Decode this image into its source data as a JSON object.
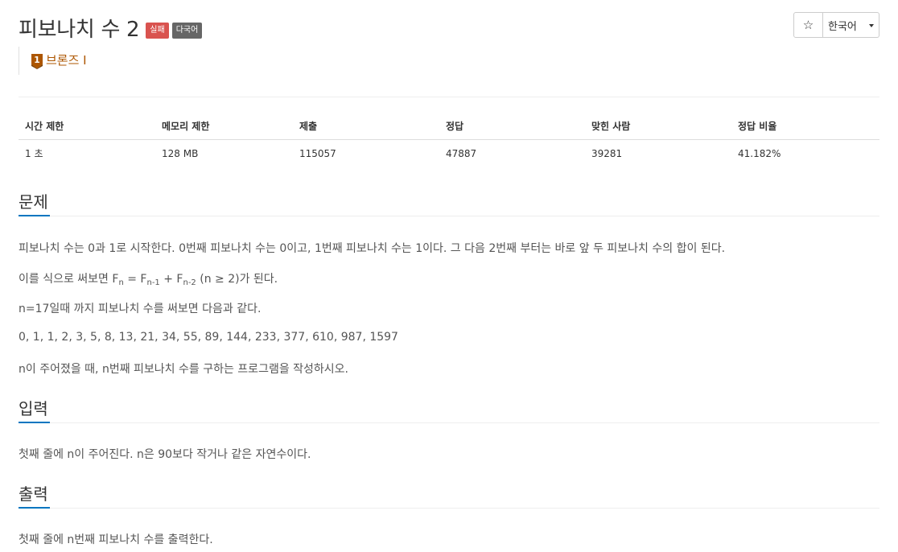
{
  "problem": {
    "title": "피보나치 수 2",
    "badges": [
      {
        "label": "실패",
        "color": "#d9534f"
      },
      {
        "label": "다국어",
        "color": "#666666"
      }
    ],
    "tier": {
      "number": "1",
      "label": "브론즈 I",
      "color": "#ad5600"
    }
  },
  "header_buttons": {
    "star_icon": "☆",
    "language": "한국어"
  },
  "info_table": {
    "headers": [
      "시간 제한",
      "메모리 제한",
      "제출",
      "정답",
      "맞힌 사람",
      "정답 비율"
    ],
    "values": [
      "1 초",
      "128 MB",
      "115057",
      "47887",
      "39281",
      "41.182%"
    ]
  },
  "sections": {
    "description": {
      "title": "문제",
      "line1": "피보나치 수는 0과 1로 시작한다. 0번째 피보나치 수는 0이고, 1번째 피보나치 수는 1이다. 그 다음 2번째 부터는 바로 앞 두 피보나치 수의 합이 된다.",
      "formula": {
        "prefix": "이를 식으로 써보면 F",
        "sub_n": "n",
        "eq": " = F",
        "sub_n1": "n-1",
        "plus": " + F",
        "sub_n2": "n-2",
        "suffix": " (n ≥ 2)가 된다."
      },
      "line3": "n=17일때 까지 피보나치 수를 써보면 다음과 같다.",
      "sequence": "0, 1, 1, 2, 3, 5, 8, 13, 21, 34, 55, 89, 144, 233, 377, 610, 987, 1597",
      "line5": "n이 주어졌을 때, n번째 피보나치 수를 구하는 프로그램을 작성하시오."
    },
    "input": {
      "title": "입력",
      "text": "첫째 줄에 n이 주어진다. n은 90보다 작거나 같은 자연수이다."
    },
    "output": {
      "title": "출력",
      "text": "첫째 줄에 n번째 피보나치 수를 출력한다."
    }
  }
}
